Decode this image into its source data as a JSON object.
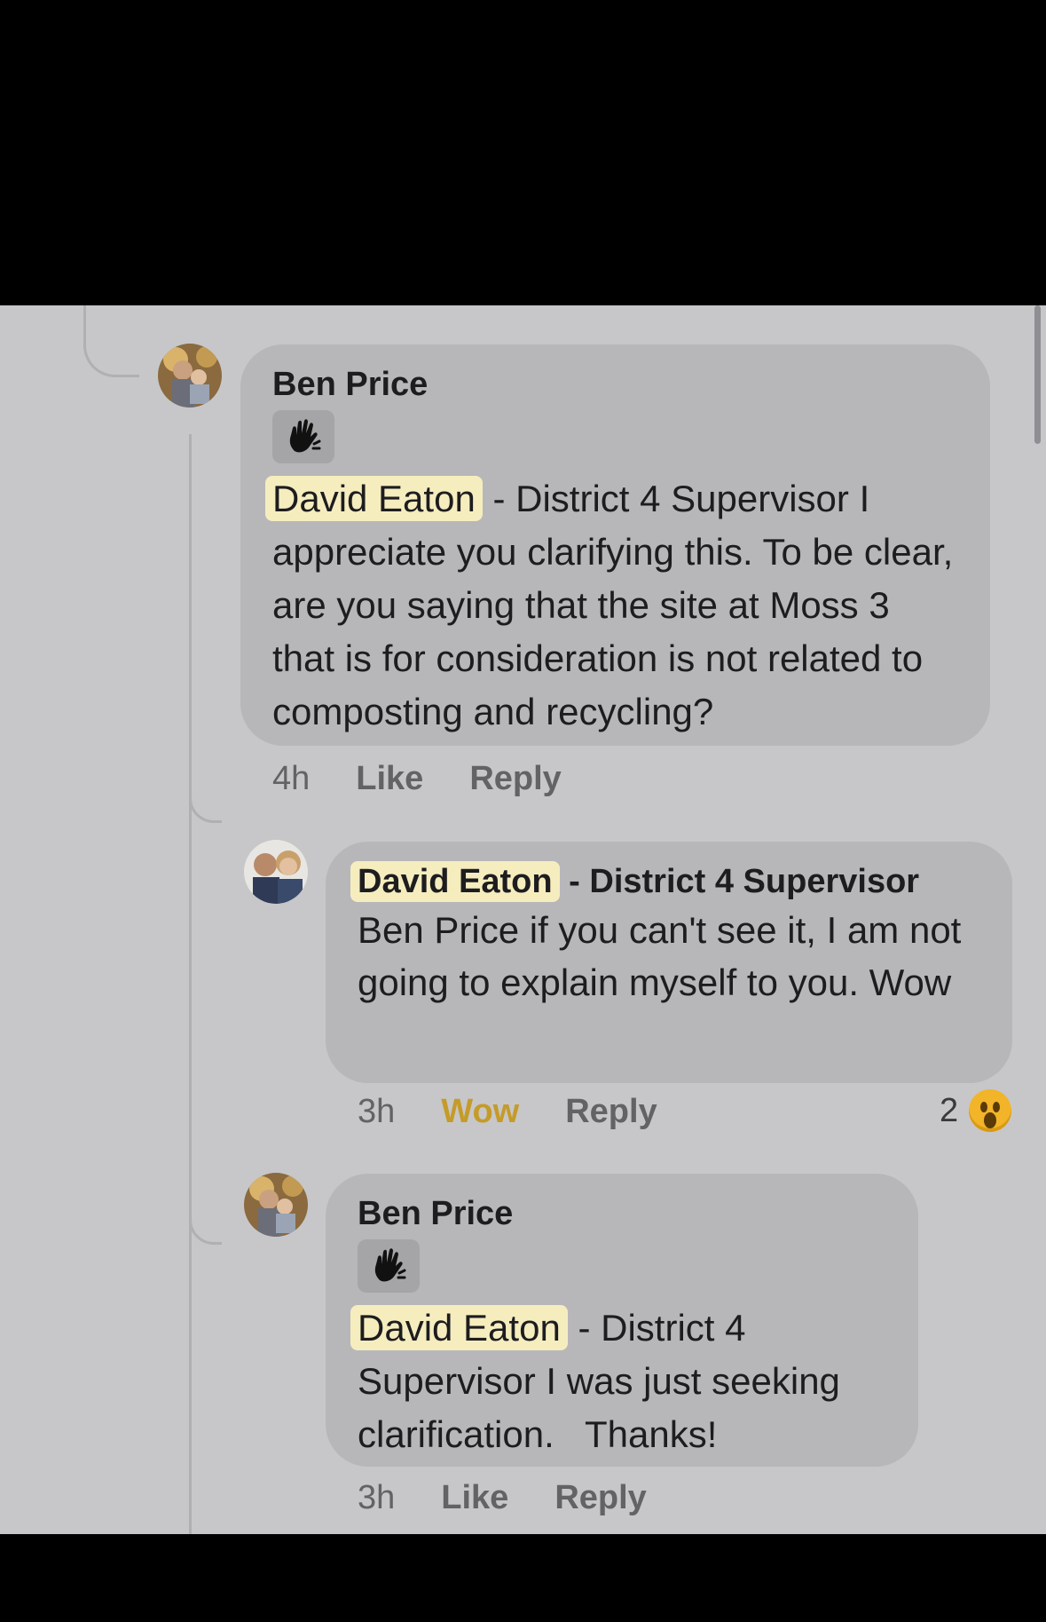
{
  "comments": [
    {
      "author": "Ben Price",
      "mention": "David Eaton",
      "text": "- District 4 Supervisor   I appreciate you clarifying this. To be clear, are you saying that the site at Moss 3 that is for consideration is not related to composting and recycling?",
      "time": "4h",
      "like_label": "Like",
      "reply_label": "Reply",
      "badge_icon": "wave-hand-icon"
    },
    {
      "author": "David Eaton",
      "author_suffix": "- District 4 Supervisor",
      "text": "Ben Price if you can't see it, I am not going to explain myself to you. Wow",
      "time": "3h",
      "reaction_label": "Wow",
      "reply_label": "Reply",
      "reaction_count": "2",
      "reaction_icon": "wow-emoji-icon"
    },
    {
      "author": "Ben Price",
      "mention": "David Eaton",
      "text": "- District 4 Supervisor I was just seeking clarification.   Thanks!",
      "time": "3h",
      "like_label": "Like",
      "reply_label": "Reply",
      "badge_icon": "wave-hand-icon"
    }
  ],
  "colors": {
    "background": "#c7c7c9",
    "bubble": "#b7b7ba",
    "mention_highlight": "#f6edbf",
    "wow_reaction": "#c59b29"
  }
}
